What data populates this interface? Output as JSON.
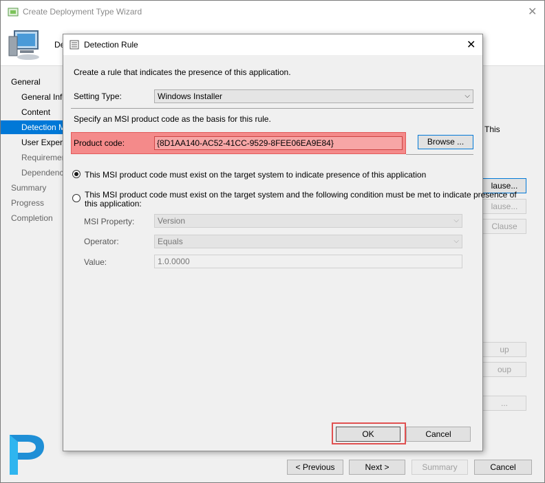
{
  "wizard": {
    "title": "Create Deployment Type Wizard",
    "header_label": "De",
    "partial_text": "This",
    "nav": [
      {
        "label": "General"
      },
      {
        "label": "General Information"
      },
      {
        "label": "Content"
      },
      {
        "label": "Detection Method"
      },
      {
        "label": "User Experience"
      },
      {
        "label": "Requirements"
      },
      {
        "label": "Dependencies"
      },
      {
        "label": "Summary"
      },
      {
        "label": "Progress"
      },
      {
        "label": "Completion"
      }
    ],
    "side_buttons": [
      "lause...",
      "lause...",
      "Clause",
      "up",
      "oup",
      "..."
    ],
    "buttons": {
      "previous": "< Previous",
      "next": "Next >",
      "summary": "Summary",
      "cancel": "Cancel"
    }
  },
  "dialog": {
    "title": "Detection Rule",
    "intro": "Create a rule that indicates the presence of this application.",
    "setting_type_label": "Setting Type:",
    "setting_type_value": "Windows Installer",
    "msi_hint": "Specify an MSI product code as the basis for this rule.",
    "product_code_label": "Product code:",
    "product_code_value": "{8D1AA140-AC52-41CC-9529-8FEE06EA9E84}",
    "browse_label": "Browse ...",
    "radio1_label": "This MSI product code must exist on the target system to indicate presence of this application",
    "radio2_line1": "This MSI product code must exist on the target system and the following condition must be met to indicate presence of",
    "radio2_line2": "this application:",
    "msi_property_label": "MSI Property:",
    "msi_property_value": "Version",
    "operator_label": "Operator:",
    "operator_value": "Equals",
    "value_label": "Value:",
    "value_value": "1.0.0000",
    "ok_label": "OK",
    "cancel_label": "Cancel"
  },
  "colors": {
    "selection": "#0078d7",
    "highlight": "#f48a8a",
    "logo": "#1f8fd6"
  }
}
